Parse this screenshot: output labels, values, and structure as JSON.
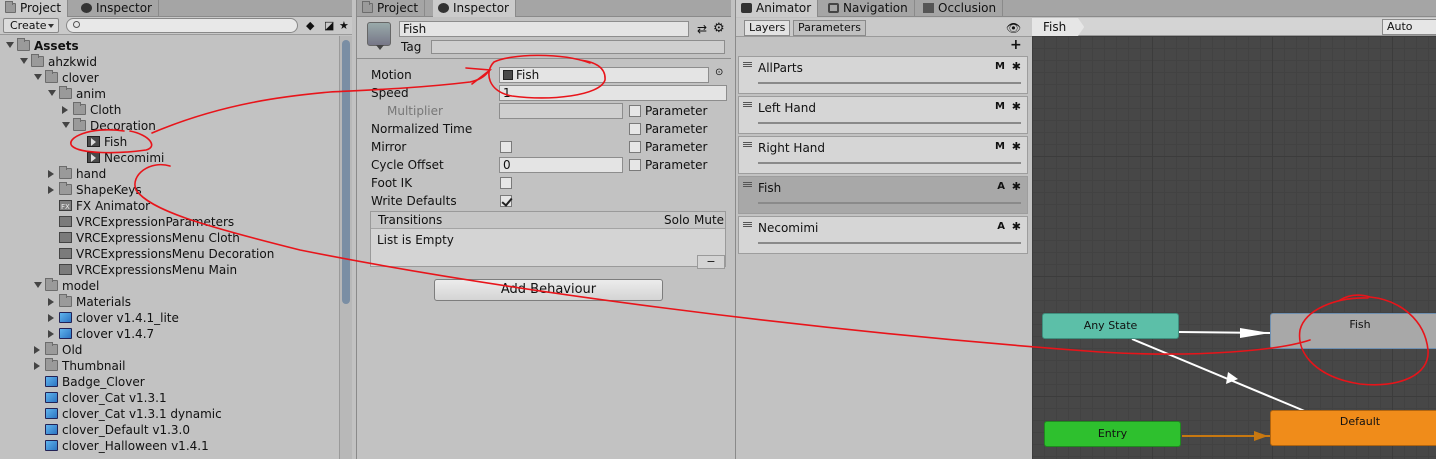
{
  "project": {
    "tabs": [
      {
        "label": "Project"
      },
      {
        "label": "Inspector"
      }
    ],
    "create_label": "Create",
    "search_placeholder": "",
    "tree": [
      {
        "label": "Assets",
        "level": 0,
        "arrow": "open",
        "icon": "folder",
        "bold": true
      },
      {
        "label": "ahzkwid",
        "level": 1,
        "arrow": "open",
        "icon": "folder"
      },
      {
        "label": "clover",
        "level": 2,
        "arrow": "open",
        "icon": "folder"
      },
      {
        "label": "anim",
        "level": 3,
        "arrow": "open",
        "icon": "folder"
      },
      {
        "label": "Cloth",
        "level": 4,
        "arrow": "closed",
        "icon": "folder"
      },
      {
        "label": "Decoration",
        "level": 4,
        "arrow": "open",
        "icon": "folder"
      },
      {
        "label": "Fish",
        "level": 5,
        "arrow": "none",
        "icon": "anim"
      },
      {
        "label": "Necomimi",
        "level": 5,
        "arrow": "none",
        "icon": "anim"
      },
      {
        "label": "hand",
        "level": 3,
        "arrow": "closed",
        "icon": "folder"
      },
      {
        "label": "ShapeKeys",
        "level": 3,
        "arrow": "closed",
        "icon": "folder"
      },
      {
        "label": "FX Animator",
        "level": 3,
        "arrow": "none",
        "icon": "controller"
      },
      {
        "label": "VRCExpressionParameters",
        "level": 3,
        "arrow": "none",
        "icon": "asset"
      },
      {
        "label": "VRCExpressionsMenu Cloth",
        "level": 3,
        "arrow": "none",
        "icon": "asset"
      },
      {
        "label": "VRCExpressionsMenu Decoration",
        "level": 3,
        "arrow": "none",
        "icon": "asset"
      },
      {
        "label": "VRCExpressionsMenu Main",
        "level": 3,
        "arrow": "none",
        "icon": "asset"
      },
      {
        "label": "model",
        "level": 2,
        "arrow": "open",
        "icon": "folder"
      },
      {
        "label": "Materials",
        "level": 3,
        "arrow": "closed",
        "icon": "folder"
      },
      {
        "label": "clover v1.4.1_lite",
        "level": 3,
        "arrow": "closed",
        "icon": "cube"
      },
      {
        "label": "clover v1.4.7",
        "level": 3,
        "arrow": "closed",
        "icon": "cube"
      },
      {
        "label": "Old",
        "level": 2,
        "arrow": "closed",
        "icon": "folder"
      },
      {
        "label": "Thumbnail",
        "level": 2,
        "arrow": "closed",
        "icon": "folder"
      },
      {
        "label": "Badge_Clover",
        "level": 2,
        "arrow": "none",
        "icon": "cube"
      },
      {
        "label": "clover_Cat v1.3.1",
        "level": 2,
        "arrow": "none",
        "icon": "cube"
      },
      {
        "label": "clover_Cat v1.3.1 dynamic",
        "level": 2,
        "arrow": "none",
        "icon": "cube"
      },
      {
        "label": "clover_Default v1.3.0",
        "level": 2,
        "arrow": "none",
        "icon": "cube"
      },
      {
        "label": "clover_Halloween v1.4.1",
        "level": 2,
        "arrow": "none",
        "icon": "cube"
      }
    ]
  },
  "inspector": {
    "tabs": [
      {
        "label": "Project"
      },
      {
        "label": "Inspector"
      }
    ],
    "object_name": "Fish",
    "tag_label": "Tag",
    "tag_value": "",
    "motion_label": "Motion",
    "motion_value": "Fish",
    "speed_label": "Speed",
    "speed_value": "1",
    "multiplier_label": "Multiplier",
    "parameter_label": "Parameter",
    "normalized_time_label": "Normalized Time",
    "mirror_label": "Mirror",
    "cycle_offset_label": "Cycle Offset",
    "cycle_offset_value": "0",
    "foot_ik_label": "Foot IK",
    "write_defaults_label": "Write Defaults",
    "write_defaults_checked": true,
    "transitions_label": "Transitions",
    "solo_label": "Solo",
    "mute_label": "Mute",
    "list_empty": "List is Empty",
    "minus": "−",
    "add_behaviour": "Add Behaviour"
  },
  "animator": {
    "tabs": [
      {
        "label": "Animator"
      },
      {
        "label": "Navigation"
      },
      {
        "label": "Occlusion"
      }
    ],
    "subtabs": [
      {
        "label": "Layers"
      },
      {
        "label": "Parameters"
      }
    ],
    "plus": "+",
    "breadcrumb": "Fish",
    "auto_live": "Auto Live",
    "layers": [
      {
        "name": "AllParts",
        "badge": "M",
        "selected": false
      },
      {
        "name": "Left Hand",
        "badge": "M",
        "selected": false
      },
      {
        "name": "Right Hand",
        "badge": "M",
        "selected": false
      },
      {
        "name": "Fish",
        "badge": "A",
        "selected": true
      },
      {
        "name": "Necomimi",
        "badge": "A",
        "selected": false
      }
    ],
    "nodes": {
      "any_state": "Any State",
      "fish": "Fish",
      "entry": "Entry",
      "default": "Default"
    }
  },
  "colors": {
    "annotation": "#e8141a",
    "any_state": "#5cbfa8",
    "entry": "#2ec02e",
    "default": "#f08c1a",
    "fish_state": "#a8a8a8"
  }
}
